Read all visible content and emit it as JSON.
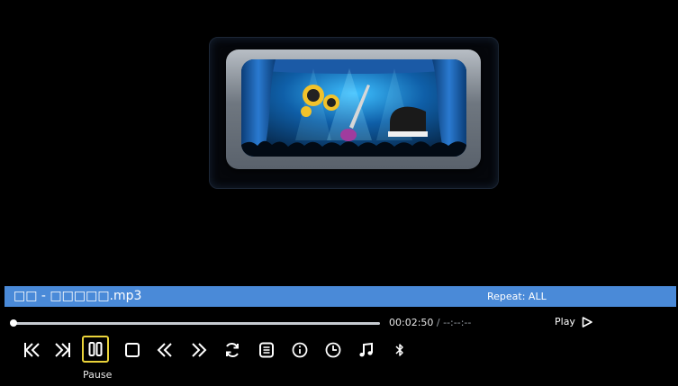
{
  "now_playing": {
    "title": "□□ - □□□□□.mp3",
    "repeat": "Repeat: ALL"
  },
  "progress": {
    "elapsed": "00:02:50",
    "total": " / --:--:--",
    "fraction": 0.0
  },
  "playback_state": {
    "label": "Play",
    "icon": "play-outline-icon"
  },
  "controls": [
    {
      "id": "previous",
      "icon": "skip-previous-icon"
    },
    {
      "id": "next",
      "icon": "skip-next-icon"
    },
    {
      "id": "pause",
      "icon": "pause-icon",
      "selected": true,
      "label": "Pause"
    },
    {
      "id": "stop",
      "icon": "stop-icon"
    },
    {
      "id": "rewind",
      "icon": "rewind-icon"
    },
    {
      "id": "fast-forward",
      "icon": "fast-forward-icon"
    },
    {
      "id": "repeat",
      "icon": "repeat-icon"
    },
    {
      "id": "playlist",
      "icon": "playlist-icon"
    },
    {
      "id": "info",
      "icon": "info-icon"
    },
    {
      "id": "sleep-timer",
      "icon": "timer-icon"
    },
    {
      "id": "sound",
      "icon": "music-note-icon"
    },
    {
      "id": "bluetooth",
      "icon": "bluetooth-icon"
    }
  ],
  "focused_control_label": "Pause",
  "colors": {
    "info_bar": "#4a8ad8",
    "selection_border": "#ead33a",
    "background": "#000000"
  }
}
